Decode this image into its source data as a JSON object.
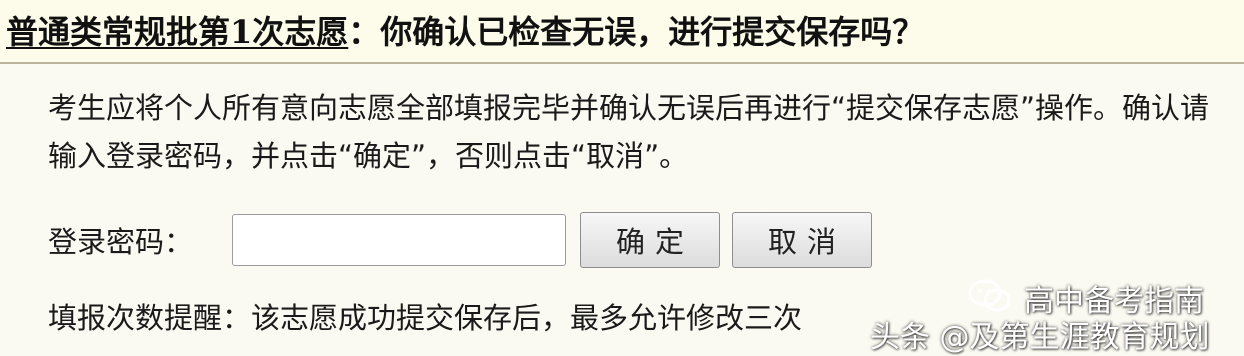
{
  "dialog": {
    "title_underlined": "普通类常规批第1次志愿",
    "title_rest": "：你确认已检查无误，进行提交保存吗？",
    "instructions": "考生应将个人所有意向志愿全部填报完毕并确认无误后再进行“提交保存志愿”操作。确认请输入登录密码，并点击“确定”，否则点击“取消”。",
    "password_label": "登录密码：",
    "password_value": "",
    "confirm_label": "确定",
    "cancel_label": "取消",
    "reminder": "填报次数提醒：该志愿成功提交保存后，最多允许修改三次"
  },
  "watermark": {
    "line1": "高中备考指南",
    "line2": "头条 @及第生涯教育规划",
    "icon": "wechat-icon"
  }
}
